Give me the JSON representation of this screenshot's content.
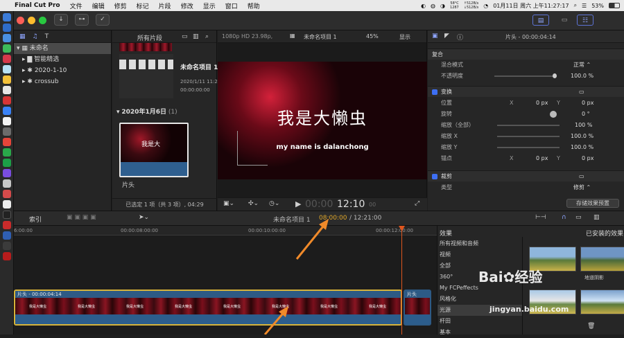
{
  "menubar": {
    "apple": "",
    "app_name": "Final Cut Pro",
    "items": [
      "文件",
      "编辑",
      "修剪",
      "标记",
      "片段",
      "修改",
      "显示",
      "窗口",
      "帮助"
    ],
    "temp_top": "58°C",
    "temp_bottom": "1287",
    "net_top": "↑512B/s",
    "net_bottom": "↓512B/s",
    "datetime": "01月11日 周六 上午11:27:17",
    "battery": "53%"
  },
  "toolbar": {
    "import_icon": "↓",
    "keyword_icon": "⊶",
    "check_icon": "✓"
  },
  "library": {
    "root": "未命名",
    "items": [
      "智能精选",
      "2020-1-10",
      "crossub"
    ]
  },
  "browser": {
    "filter": "所有片段",
    "project_title": "未命名项目 1",
    "project_date": "2020/1/11 11:2",
    "project_time": "00:00:00:00",
    "event_header": "2020年1月6日",
    "event_count": "(1)",
    "clip_caption": "片头",
    "clip_text": "我是大",
    "status": "已选定 1 项（共 3 项）, 04:29"
  },
  "viewer": {
    "format": "1080p HD 23.98p,",
    "project": "未命名项目 1",
    "zoom": "45%",
    "view_menu": "显示",
    "title_cn": "我是大懒虫",
    "title_en": "my name is dalanchong",
    "timecode_dim": "00:00",
    "timecode": "12:10",
    "timecode_frames": "00"
  },
  "inspector": {
    "header": "片头 - 00:00:04:14",
    "composite": "复合",
    "blend_label": "混合模式",
    "blend_value": "正常 ⌃",
    "opacity_label": "不透明度",
    "opacity_value": "100.0 %",
    "transform": "变换",
    "position_label": "位置",
    "pos_x_label": "X",
    "pos_x": "0 px",
    "pos_y_label": "Y",
    "pos_y": "0 px",
    "rotation_label": "旋转",
    "rotation_value": "0 °",
    "scale_all_label": "缩放（全部）",
    "scale_all": "100 %",
    "scale_x_label": "缩放 X",
    "scale_x": "100.0 %",
    "scale_y_label": "缩放 Y",
    "scale_y": "100.0 %",
    "anchor_label": "锚点",
    "anchor_x_label": "X",
    "anchor_x": "0 px",
    "anchor_y_label": "Y",
    "anchor_y": "0 px",
    "crop": "裁剪",
    "type_label": "类型",
    "type_value": "修剪 ⌃",
    "save_preset": "存储效果预置"
  },
  "timeline": {
    "index": "索引",
    "project": "未命名项目 1",
    "position": "08:00:00",
    "duration": "/ 12:21:00",
    "ruler": [
      "6:00:00",
      "00:00:08:00:00",
      "00:00:10:00:00",
      "00:00:12:00:00"
    ],
    "clip1_label": "片头 - 00:00:04:14",
    "clip2_label": "片头",
    "clip_frame_text": "我是大懒虫"
  },
  "effects": {
    "header": "效果",
    "installed": "已安装的效果",
    "categories": [
      "所有视频和音频",
      "视频",
      "全部",
      "360°",
      "My FCPeffects",
      "风格化",
      "光源",
      "杆田",
      "基本"
    ],
    "thumb_labels": [
      "",
      "地道阴影",
      "",
      ""
    ]
  },
  "watermark": {
    "brand_a": "Bai",
    "brand_b": "经验",
    "url": "jingyan.baidu.com"
  },
  "colors": {
    "accent": "#3d6ff4",
    "playhead": "#e0561e",
    "clip_border": "#d6b33a",
    "timecode_highlight": "#e0a72a"
  }
}
